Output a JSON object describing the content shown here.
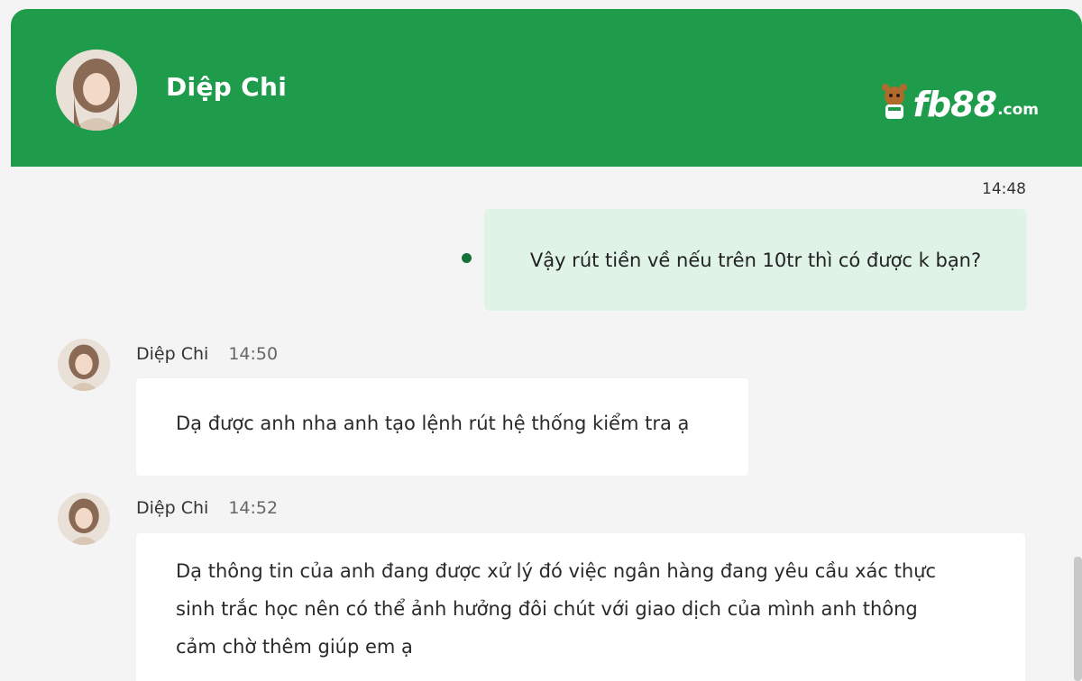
{
  "header": {
    "contact_name": "Diệp Chi",
    "logo_text": "fb88",
    "logo_suffix": ".com",
    "brand_color": "#1f9b4c"
  },
  "messages": [
    {
      "direction": "outgoing",
      "time": "14:48",
      "text": "Vậy rút tiền về nếu trên 10tr thì có được k bạn?"
    },
    {
      "direction": "incoming",
      "sender": "Diệp Chi",
      "time": "14:50",
      "text": "Dạ được anh nha anh tạo lệnh rút hệ thống kiểm tra ạ"
    },
    {
      "direction": "incoming",
      "sender": "Diệp Chi",
      "time": "14:52",
      "lines": [
        "Dạ thông tin của anh đang được xử lý đó việc ngân hàng đang yêu cầu xác thực",
        "sinh trắc học nên có thể ảnh hưởng đôi chút với giao dịch của mình anh thông",
        "cảm chờ thêm giúp em ạ"
      ]
    }
  ],
  "colors": {
    "outgoing_bubble": "#dff4e6",
    "incoming_bubble": "#ffffff",
    "sent_indicator": "#15703a",
    "background": "#f4f4f4"
  }
}
